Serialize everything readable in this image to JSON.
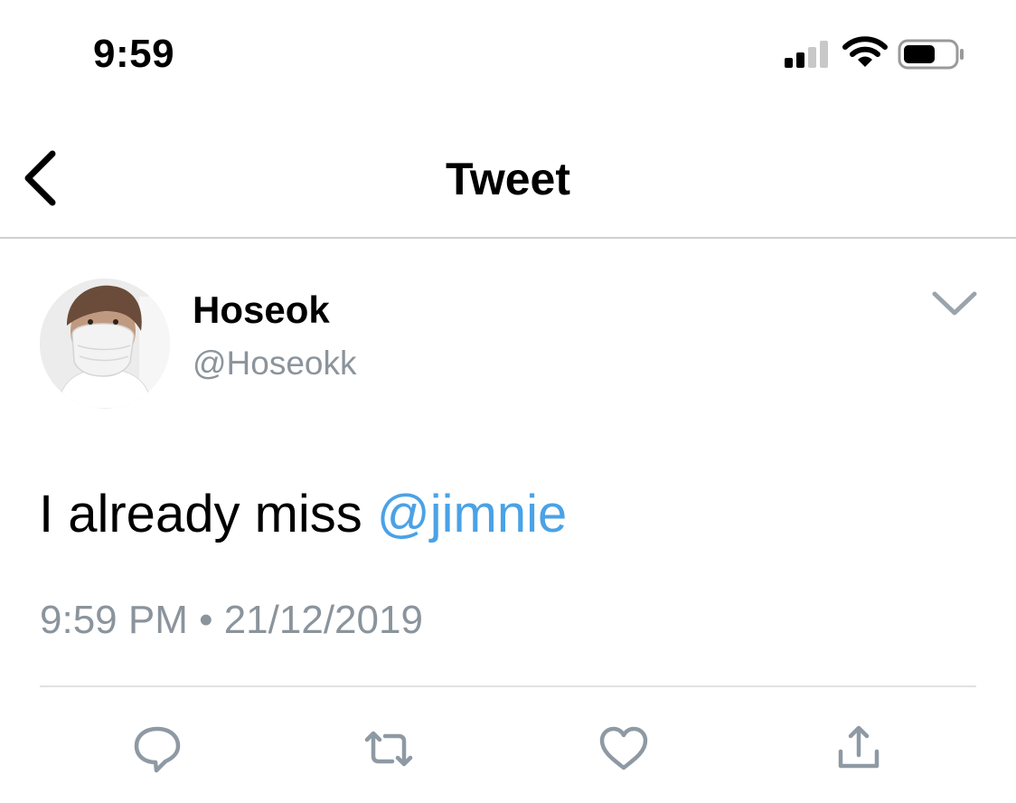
{
  "status_bar": {
    "time": "9:59",
    "icons": [
      "cellular-signal-icon",
      "wifi-icon",
      "battery-icon"
    ]
  },
  "nav": {
    "back_icon": "chevron-left-icon",
    "title": "Tweet"
  },
  "tweet": {
    "author": {
      "display_name": "Hoseok",
      "handle": "@Hoseokk",
      "avatar": "avatar-photo"
    },
    "text_prefix": "I already miss ",
    "mention": "@jimnie",
    "timestamp": "9:59 PM • 21/12/2019",
    "menu_icon": "chevron-down-icon"
  },
  "actions": [
    "reply-icon",
    "retweet-icon",
    "like-icon",
    "share-icon"
  ],
  "colors": {
    "mention": "#4aa2e6",
    "secondary_text": "#8b949c",
    "icon_gray": "#8e99a3",
    "divider": "#cfcfd2"
  }
}
